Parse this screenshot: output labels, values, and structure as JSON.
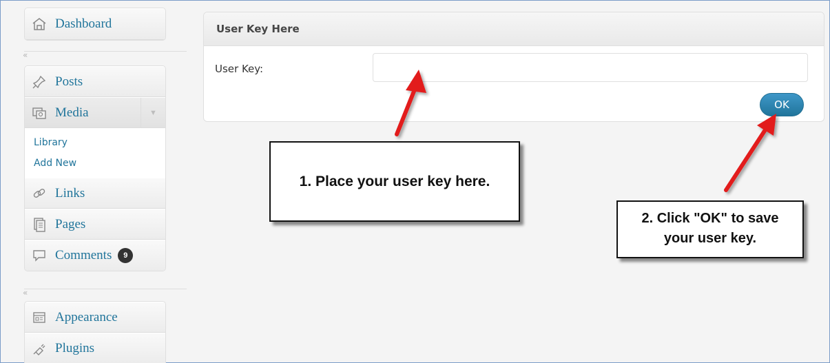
{
  "sidebar": {
    "items": [
      {
        "label": "Dashboard",
        "icon": "dashboard-icon"
      },
      {
        "label": "Posts",
        "icon": "pushpin-icon"
      },
      {
        "label": "Media",
        "icon": "media-icon"
      },
      {
        "label": "Links",
        "icon": "links-icon"
      },
      {
        "label": "Pages",
        "icon": "pages-icon"
      },
      {
        "label": "Comments",
        "icon": "comments-icon",
        "badge": "9"
      },
      {
        "label": "Appearance",
        "icon": "appearance-icon"
      },
      {
        "label": "Plugins",
        "icon": "plugins-icon"
      }
    ],
    "media_submenu": [
      "Library",
      "Add New"
    ],
    "collapse_glyph": "«",
    "toggle_glyph": "▼"
  },
  "panel": {
    "title": "User Key Here",
    "field_label": "User Key:",
    "input_value": "",
    "ok_label": "OK"
  },
  "callouts": {
    "first": "1. Place your user key here.",
    "second_line1": "2. Click \"OK\" to save",
    "second_line2": "your user key."
  },
  "colors": {
    "link": "#21759b",
    "ok_button": "#21759b",
    "arrow": "#e21b1b",
    "badge": "#333333"
  }
}
